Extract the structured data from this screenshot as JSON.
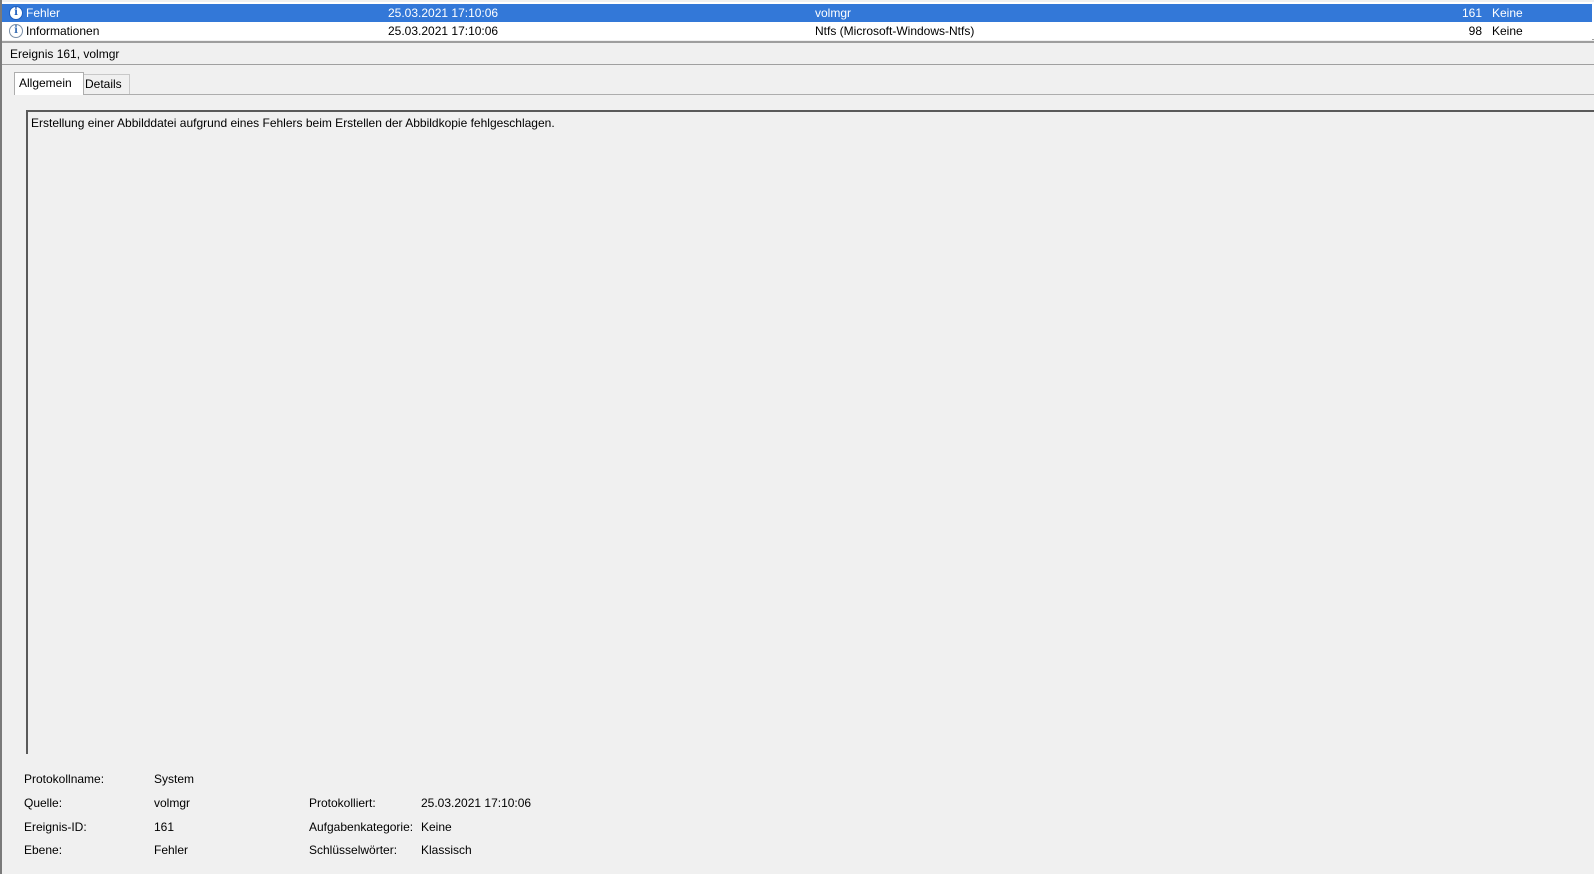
{
  "event_list": {
    "rows": [
      {
        "level": "Fehler",
        "icon": "error-info-icon",
        "date": "25.03.2021 17:10:06",
        "source": "volmgr",
        "event_id": "161",
        "category": "Keine",
        "selected": true
      },
      {
        "level": "Informationen",
        "icon": "info-icon",
        "date": "25.03.2021 17:10:06",
        "source": "Ntfs (Microsoft-Windows-Ntfs)",
        "event_id": "98",
        "category": "Keine",
        "selected": false
      }
    ]
  },
  "detail": {
    "title": "Ereignis 161, volmgr",
    "tabs": [
      {
        "label": "Allgemein",
        "active": true
      },
      {
        "label": "Details",
        "active": false
      }
    ],
    "message": "Erstellung einer Abbilddatei aufgrund eines Fehlers beim Erstellen der Abbildkopie fehlgeschlagen."
  },
  "properties": {
    "protokollname": {
      "label": "Protokollname:",
      "value": "System"
    },
    "quelle": {
      "label": "Quelle:",
      "value": "volmgr"
    },
    "protokolliert": {
      "label": "Protokolliert:",
      "value": "25.03.2021 17:10:06"
    },
    "ereignis_id": {
      "label": "Ereignis-ID:",
      "value": "161"
    },
    "aufgabenkategorie": {
      "label": "Aufgabenkategorie:",
      "value": "Keine"
    },
    "ebene": {
      "label": "Ebene:",
      "value": "Fehler"
    },
    "schluesselwoerter": {
      "label": "Schlüsselwörter:",
      "value": "Klassisch"
    }
  },
  "colors": {
    "selection": "#3378d8",
    "window_bg": "#f0f0f0"
  }
}
